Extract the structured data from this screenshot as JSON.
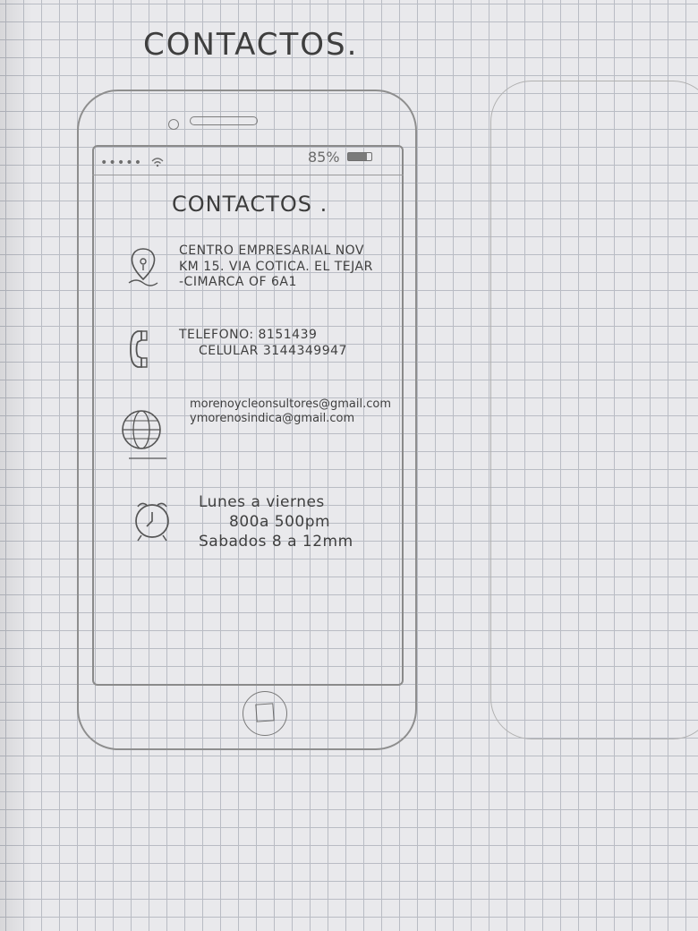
{
  "sketch": {
    "title": "CONTACTOS."
  },
  "status_bar": {
    "signal": "•••••",
    "battery_percent": "85%"
  },
  "screen": {
    "title": "CONTACTOS .",
    "address": {
      "icon": "map-pin-icon",
      "line1": "CENTRO EMPRESARIAL NOV",
      "line2": "KM 15. VIA COTICA. EL TEJAR",
      "line3": "-CIMARCA OF 6A1"
    },
    "phone": {
      "icon": "telephone-icon",
      "line1": "TELEFONO: 8151439",
      "line2": "CELULAR 3144349947"
    },
    "email": {
      "icon": "globe-icon",
      "line1": "morenoycleonsultores@gmail.com",
      "line2": "ymorenosindica@gmail.com"
    },
    "hours": {
      "icon": "alarm-clock-icon",
      "line1": "Lunes a viernes",
      "line2": "800a 500pm",
      "line3": "Sabados 8 a 12mm"
    }
  }
}
